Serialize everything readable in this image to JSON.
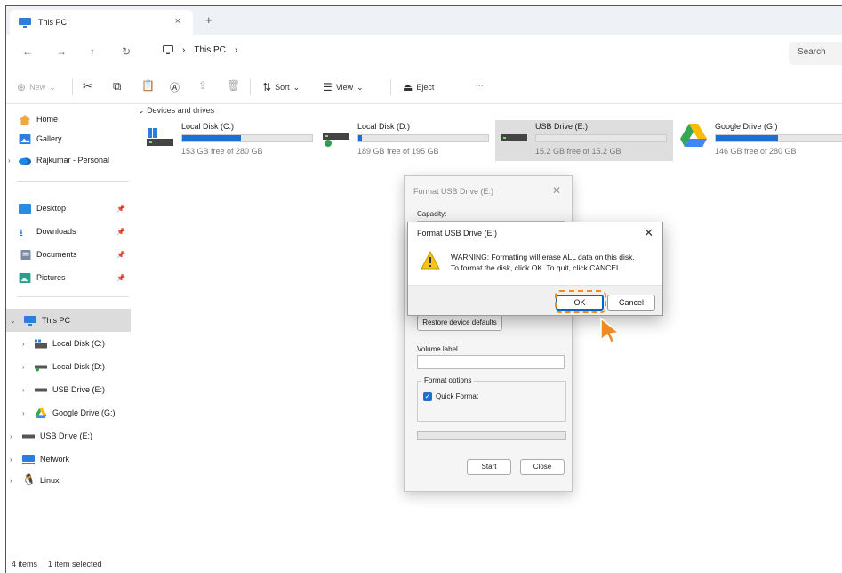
{
  "window": {
    "tab_title": "This PC",
    "tab_close": "×",
    "new_tab": "+"
  },
  "address": {
    "crumbs": [
      "This PC"
    ],
    "search_placeholder": "Search"
  },
  "toolbar": {
    "new_label": "New",
    "sort_label": "Sort",
    "view_label": "View",
    "eject_label": "Eject",
    "more_label": "···"
  },
  "sidebar": {
    "quick": [
      {
        "label": "Home",
        "icon": "home-icon"
      },
      {
        "label": "Gallery",
        "icon": "gallery-icon"
      },
      {
        "label": "Rajkumar - Personal",
        "icon": "onedrive-icon"
      }
    ],
    "pinned": [
      {
        "label": "Desktop",
        "icon": "desktop-icon"
      },
      {
        "label": "Downloads",
        "icon": "downloads-icon"
      },
      {
        "label": "Documents",
        "icon": "documents-icon"
      },
      {
        "label": "Pictures",
        "icon": "pictures-icon"
      }
    ],
    "tree": [
      {
        "label": "This PC",
        "icon": "pc-icon",
        "level": 0,
        "selected": true
      },
      {
        "label": "Local Disk (C:)",
        "icon": "windows-drive-icon",
        "level": 1
      },
      {
        "label": "Local Disk (D:)",
        "icon": "drive-icon",
        "level": 1
      },
      {
        "label": "USB Drive (E:)",
        "icon": "usb-icon",
        "level": 1
      },
      {
        "label": "Google Drive (G:)",
        "icon": "google-drive-icon",
        "level": 1
      },
      {
        "label": "USB Drive (E:)",
        "icon": "usb-icon",
        "level": 0
      },
      {
        "label": "Network",
        "icon": "network-icon",
        "level": 0
      },
      {
        "label": "Linux",
        "icon": "linux-icon",
        "level": 0
      }
    ]
  },
  "content": {
    "section_label": "Devices and drives",
    "drives": [
      {
        "name": "Local Disk (C:)",
        "free": "153 GB free of 280 GB",
        "used_fraction": 0.45
      },
      {
        "name": "Local Disk (D:)",
        "free": "189 GB free of 195 GB",
        "used_fraction": 0.03
      },
      {
        "name": "USB Drive (E:)",
        "free": "15.2 GB free of 15.2 GB",
        "used_fraction": 0.0
      },
      {
        "name": "Google Drive (G:)",
        "free": "146 GB free of 280 GB",
        "used_fraction": 0.48
      }
    ]
  },
  "status": {
    "items": "4 items",
    "selected": "1 item selected"
  },
  "format_dialog": {
    "title": "Format USB Drive (E:)",
    "close": "✕",
    "capacity_label": "Capacity:",
    "restore_label": "Restore device defaults",
    "volume_label": "Volume label",
    "options_label": "Format options",
    "quick_format_label": "Quick Format",
    "start_label": "Start",
    "close_label": "Close"
  },
  "warning_dialog": {
    "title": "Format USB Drive (E:)",
    "close": "✕",
    "line1": "WARNING: Formatting will erase ALL data on this disk.",
    "line2": "To format the disk, click OK. To quit, click CANCEL.",
    "ok_label": "OK",
    "cancel_label": "Cancel"
  },
  "colors": {
    "accent": "#1f6fd1",
    "highlight": "#f08a24"
  }
}
